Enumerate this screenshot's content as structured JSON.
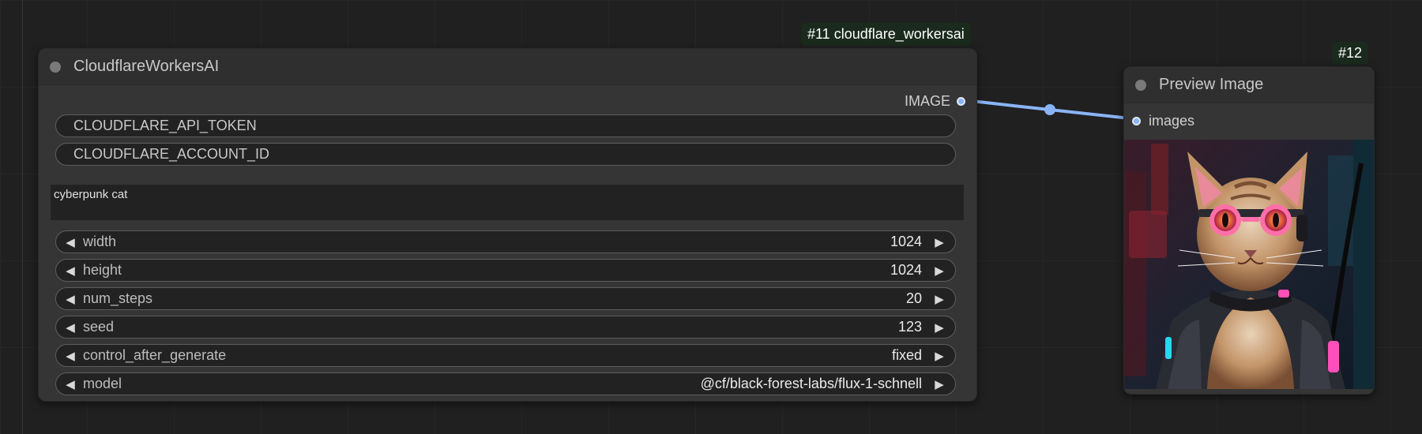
{
  "canvas": {
    "link_color": "#8ab4f8"
  },
  "badges": {
    "cf_node": "#11 cloudflare_workersai",
    "preview_node": "#12"
  },
  "cf_node": {
    "title": "CloudflareWorkersAI",
    "output_label": "IMAGE",
    "api_token_placeholder": "CLOUDFLARE_API_TOKEN",
    "account_id_placeholder": "CLOUDFLARE_ACCOUNT_ID",
    "prompt": "cyberpunk cat",
    "widgets": [
      {
        "label": "width",
        "value": "1024"
      },
      {
        "label": "height",
        "value": "1024"
      },
      {
        "label": "num_steps",
        "value": "20"
      },
      {
        "label": "seed",
        "value": "123"
      },
      {
        "label": "control_after_generate",
        "value": "fixed"
      },
      {
        "label": "model",
        "value": "@cf/black-forest-labs/flux-1-schnell"
      }
    ]
  },
  "preview_node": {
    "title": "Preview Image",
    "input_label": "images"
  }
}
